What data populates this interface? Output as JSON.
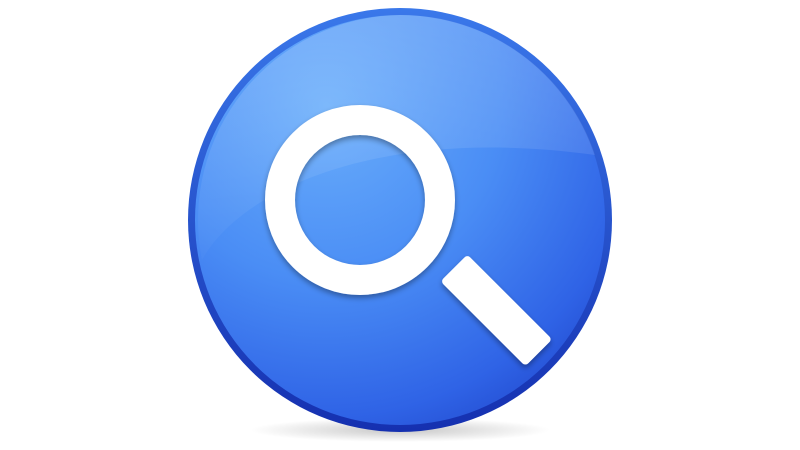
{
  "icon": {
    "name": "search-icon",
    "colors": {
      "background": "#ffffff",
      "circle_light": "#5fa4f7",
      "circle_mid": "#3c7cf0",
      "circle_dark": "#1b3fc7",
      "rim": "#1a37b8",
      "glyph": "#ffffff"
    }
  }
}
